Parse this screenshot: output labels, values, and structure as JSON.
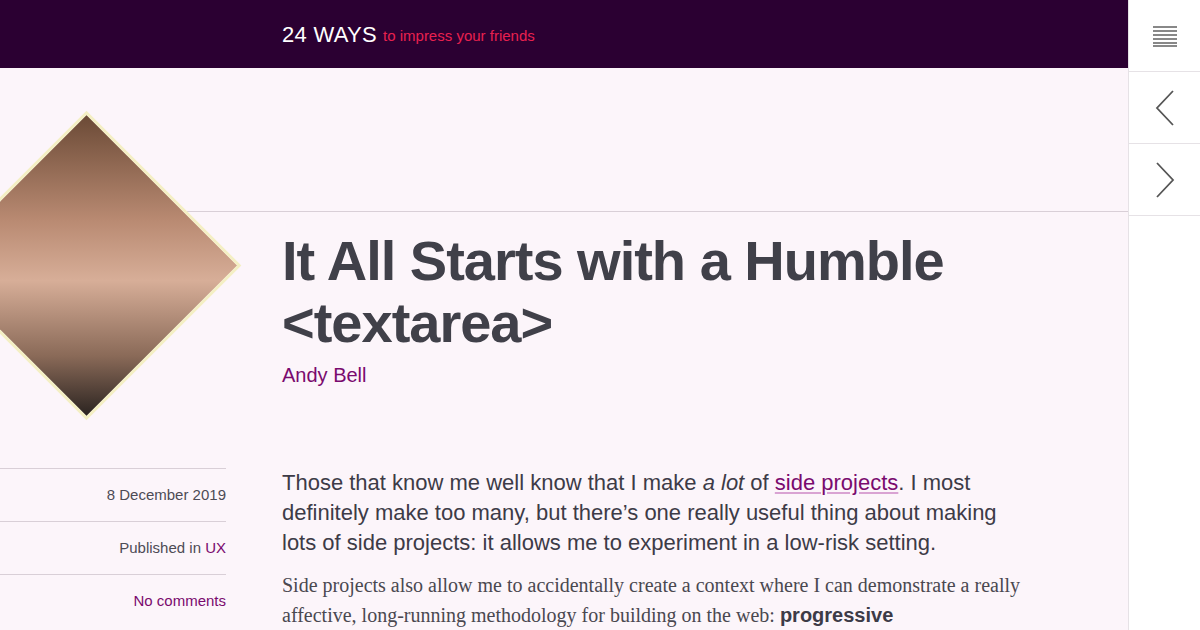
{
  "site": {
    "name": "24 WAYS",
    "tagline": "to impress your friends"
  },
  "article": {
    "title": "It All Starts with a Humble <textarea>",
    "author": "Andy Bell",
    "date": "8 December 2019",
    "category_label": "Published in ",
    "category": "UX",
    "comments": "No comments",
    "intro": [
      {
        "kind": "text",
        "text": "Those that know me well know that I make "
      },
      {
        "kind": "em",
        "text": "a lot"
      },
      {
        "kind": "text",
        "text": " of "
      },
      {
        "kind": "link",
        "text": "side projects"
      },
      {
        "kind": "text",
        "text": ". I most definitely make too many, but there’s one really useful thing about making lots of side projects: it allows me to experiment in a low-risk setting."
      }
    ],
    "paragraph": [
      {
        "kind": "text",
        "text": "Side projects also allow me to accidentally create a context where I can demonstrate a really affective, long-running methodology for building on the web: "
      },
      {
        "kind": "strong",
        "text": "progressive"
      }
    ]
  }
}
